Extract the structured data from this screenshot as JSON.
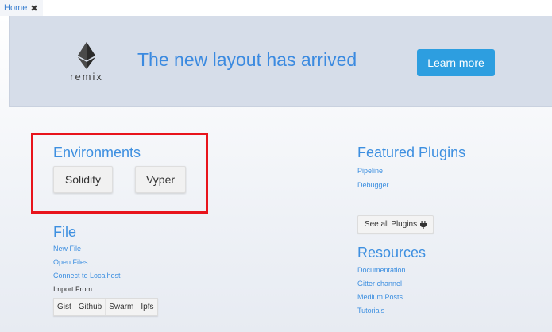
{
  "tab": {
    "label": "Home",
    "close_glyph": "✖"
  },
  "banner": {
    "logo_text": "remix",
    "title": "The new layout has arrived",
    "learn_more_label": "Learn more"
  },
  "environments": {
    "heading": "Environments",
    "buttons": [
      "Solidity",
      "Vyper"
    ]
  },
  "file": {
    "heading": "File",
    "links": [
      "New File",
      "Open Files",
      "Connect to Localhost"
    ],
    "import_label": "Import From:",
    "import_buttons": [
      "Gist",
      "Github",
      "Swarm",
      "Ipfs"
    ]
  },
  "featured_plugins": {
    "heading": "Featured Plugins",
    "links": [
      "Pipeline",
      "Debugger"
    ],
    "see_all_label": "See all Plugins",
    "see_all_icon": "plug-icon"
  },
  "resources": {
    "heading": "Resources",
    "links": [
      "Documentation",
      "Gitter channel",
      "Medium Posts",
      "Tutorials"
    ]
  },
  "colors": {
    "accent": "#3d8fe0",
    "button": "#2d9ee0",
    "banner_bg": "#d6dde9",
    "highlight_border": "#e8141c"
  }
}
